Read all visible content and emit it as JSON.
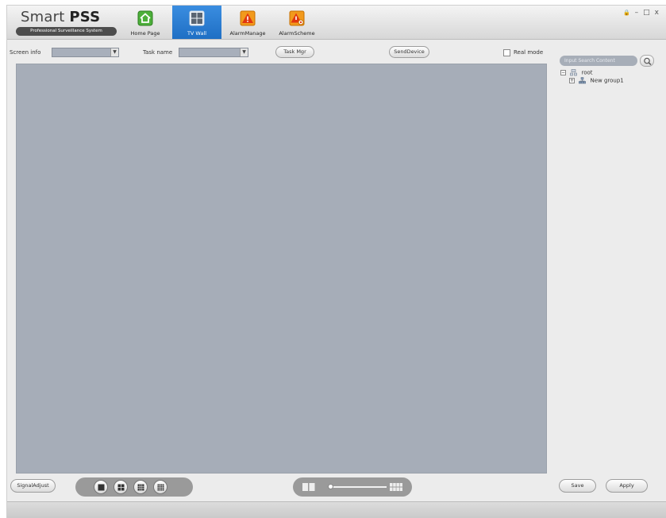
{
  "app": {
    "title_plain": "Smart",
    "title_bold": "PSS",
    "subtitle": "Professional Surveillance System"
  },
  "nav": {
    "home_label": "Home Page",
    "tvwall_label": "TV Wall",
    "alarm_manage_label": "AlarmManage",
    "alarm_scheme_label": "AlarmScheme"
  },
  "window_controls": {
    "lock": "🔒",
    "minimize": "–",
    "restore": "□",
    "close": "x"
  },
  "toolbar": {
    "screen_info_label": "Screen info",
    "screen_info_value": "",
    "task_name_label": "Task name",
    "task_name_value": "",
    "task_mgr_label": "Task Mgr",
    "send_device_label": "SendDevice",
    "real_mode_label": "Real mode",
    "real_mode_checked": false
  },
  "right_panel": {
    "search_placeholder": "Input Search Content",
    "tree": [
      {
        "label": "root",
        "toggle": "−"
      },
      {
        "label": "New group1",
        "toggle": "+"
      }
    ]
  },
  "bottom": {
    "signal_adjust_label": "SignalAdjust",
    "save_label": "Save",
    "apply_label": "Apply"
  },
  "colors": {
    "active_tab": "#2a7dd3",
    "wall_bg": "#a6adb8",
    "home_icon": "#4caf3a",
    "alarm_icon": "#f08a12"
  }
}
